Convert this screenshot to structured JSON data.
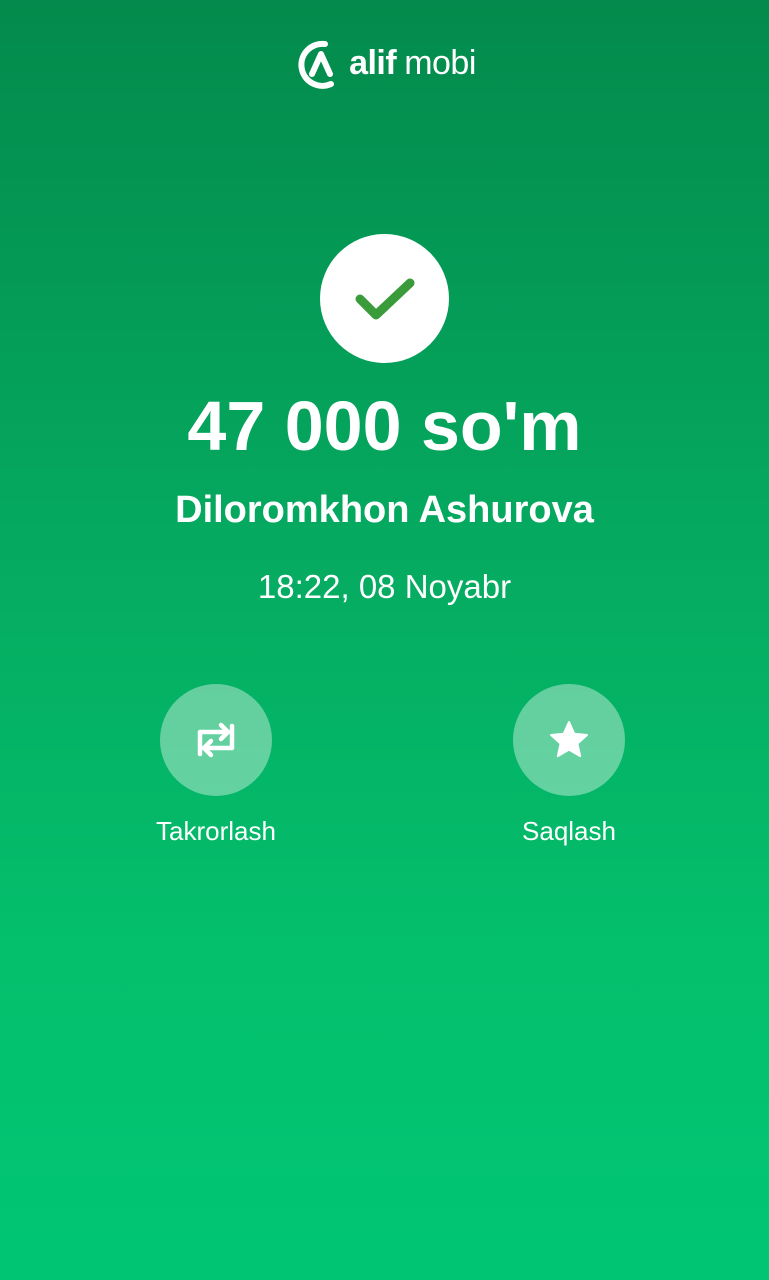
{
  "header": {
    "logo_brand": "alif",
    "logo_suffix": "mobi",
    "logo_icon": "alif-logo-icon"
  },
  "status": {
    "icon": "check-icon",
    "icon_color": "#3a9b3b"
  },
  "transaction": {
    "amount": "47 000 so'm",
    "recipient": "Diloromkhon Ashurova",
    "datetime": "18:22, 08 Noyabr"
  },
  "actions": [
    {
      "label": "Takrorlash",
      "icon": "repeat-icon"
    },
    {
      "label": "Saqlash",
      "icon": "star-icon"
    }
  ],
  "colors": {
    "background_top": "#038a4c",
    "background_bottom": "#00c674",
    "accent": "#ffffff"
  }
}
